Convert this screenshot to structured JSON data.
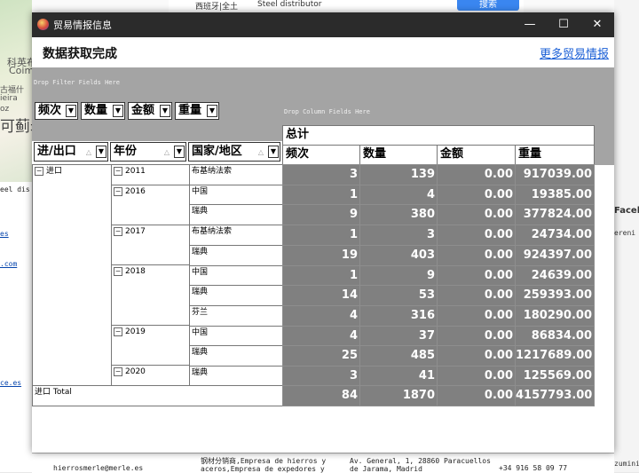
{
  "background": {
    "map_labels": [
      "科英布",
      "Coim",
      "古福什",
      "ieira",
      "oz",
      "可蓟矛"
    ],
    "search_button": "搜索",
    "top_search_text": "Steel distributor",
    "top_city_text": "西班牙|全土",
    "right_side_texts": [
      "Faceb",
      "ereni",
      "zumini"
    ],
    "left_side_links": [
      "eel dis",
      "es",
      ".com",
      "ce.es"
    ],
    "bottom_row": {
      "email": "hierrosmerle@merle.es",
      "description": "钢材分销商,Empresa de hierros y aceros,Empresa de expedores y",
      "address": "Av. General, 1, 28860 Paracuellos de Jarama, Madrid",
      "phone": "+34 916 58 09 77"
    }
  },
  "window": {
    "title": "贸易情报信息",
    "minimize_glyph": "—",
    "maximize_glyph": "☐",
    "close_glyph": "✕"
  },
  "header": {
    "title": "数据获取完成",
    "more_link": "更多贸易情报"
  },
  "pivot": {
    "filter_hint": "Drop Filter Fields Here",
    "column_hint": "Drop Column Fields Here",
    "data_fields": [
      "频次",
      "数量",
      "金额",
      "重量"
    ],
    "row_fields": [
      "进/出口",
      "年份",
      "国家/地区"
    ],
    "grand_total_header": "总计",
    "value_headers": [
      "频次",
      "数量",
      "金额",
      "重量"
    ],
    "level1": [
      {
        "label": "进口"
      }
    ],
    "years": [
      {
        "label": "2011"
      },
      {
        "label": "2016"
      },
      {
        "label": "2017"
      },
      {
        "label": "2018"
      },
      {
        "label": "2019"
      },
      {
        "label": "2020"
      }
    ],
    "rows": [
      {
        "country": "布基纳法索",
        "freq": "3",
        "qty": "139",
        "amount": "0.00",
        "weight": "917039.00"
      },
      {
        "country": "中国",
        "freq": "1",
        "qty": "4",
        "amount": "0.00",
        "weight": "19385.00"
      },
      {
        "country": "瑞典",
        "freq": "9",
        "qty": "380",
        "amount": "0.00",
        "weight": "377824.00"
      },
      {
        "country": "布基纳法索",
        "freq": "1",
        "qty": "3",
        "amount": "0.00",
        "weight": "24734.00"
      },
      {
        "country": "瑞典",
        "freq": "19",
        "qty": "403",
        "amount": "0.00",
        "weight": "924397.00"
      },
      {
        "country": "中国",
        "freq": "1",
        "qty": "9",
        "amount": "0.00",
        "weight": "24639.00"
      },
      {
        "country": "瑞典",
        "freq": "14",
        "qty": "53",
        "amount": "0.00",
        "weight": "259393.00"
      },
      {
        "country": "芬兰",
        "freq": "4",
        "qty": "316",
        "amount": "0.00",
        "weight": "180290.00"
      },
      {
        "country": "中国",
        "freq": "4",
        "qty": "37",
        "amount": "0.00",
        "weight": "86834.00"
      },
      {
        "country": "瑞典",
        "freq": "25",
        "qty": "485",
        "amount": "0.00",
        "weight": "1217689.00"
      },
      {
        "country": "瑞典",
        "freq": "3",
        "qty": "41",
        "amount": "0.00",
        "weight": "125569.00"
      }
    ],
    "total": {
      "label": "进口 Total",
      "freq": "84",
      "qty": "1870",
      "amount": "0.00",
      "weight": "4157793.00"
    }
  }
}
